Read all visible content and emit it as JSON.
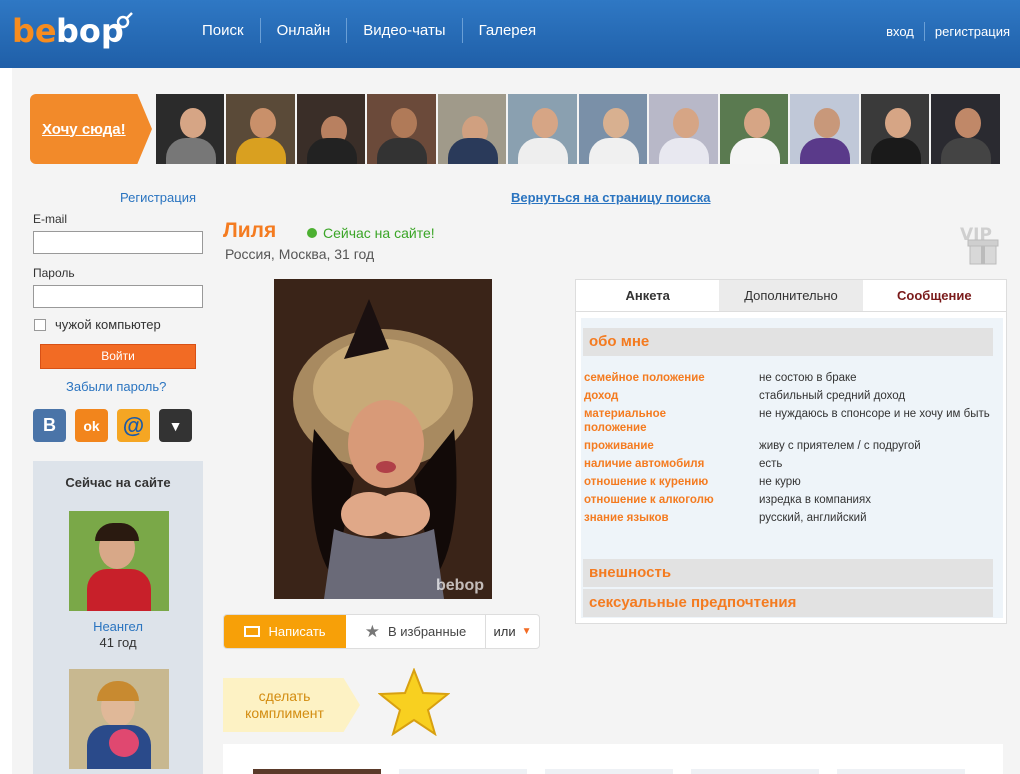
{
  "header": {
    "logo": "bebop",
    "nav": [
      "Поиск",
      "Онлайн",
      "Видео-чаты",
      "Галерея"
    ],
    "login": "вход",
    "register": "регистрация"
  },
  "strip": {
    "want_here": "Хочу сюда!"
  },
  "sidebar": {
    "register_link": "Регистрация",
    "email_label": "E-mail",
    "password_label": "Пароль",
    "foreign_pc": "чужой компьютер",
    "login_button": "Войти",
    "forgot": "Забыли пароль?",
    "socials": [
      "В",
      "ok",
      "@",
      "▼"
    ],
    "online_title": "Сейчас на сайте",
    "online_people": [
      {
        "name": "Неангел",
        "age": "41 год"
      },
      {
        "name": "",
        "age": ""
      }
    ]
  },
  "profile": {
    "back_link": "Вернуться на страницу поиска",
    "name": "Лиля",
    "online_status": "Сейчас на сайте!",
    "location": "Россия, Москва, 31 год",
    "photo_watermark": "bebop",
    "actions": {
      "write": "Написать",
      "favorite": "В избранные",
      "or": "или"
    },
    "compliment": "сделать комплимент"
  },
  "panel": {
    "tabs": [
      "Анкета",
      "Дополнительно",
      "Сообщение"
    ],
    "about_title": "обо мне",
    "rows": [
      {
        "k": "семейное положение",
        "v": "не состою в браке"
      },
      {
        "k": "доход",
        "v": "стабильный средний доход"
      },
      {
        "k": "материальное положение",
        "v": "не нуждаюсь в спонсоре и не хочу им быть"
      },
      {
        "k": "проживание",
        "v": "живу с приятелем / с подругой"
      },
      {
        "k": "наличие автомобиля",
        "v": "есть"
      },
      {
        "k": "отношение к курению",
        "v": "не курю"
      },
      {
        "k": "отношение к алкоголю",
        "v": "изредка в компаниях"
      },
      {
        "k": "знание языков",
        "v": "русский, английский"
      }
    ],
    "appearance_title": "внешность",
    "preferences_title": "сексуальные предпочтения"
  },
  "colors": {
    "header_blue": "#2f78c4",
    "accent_orange": "#f47b20",
    "login_orange": "#f26b24",
    "write_orange": "#f7a008",
    "online_green": "#3aa526",
    "link_blue": "#2a74c0"
  }
}
